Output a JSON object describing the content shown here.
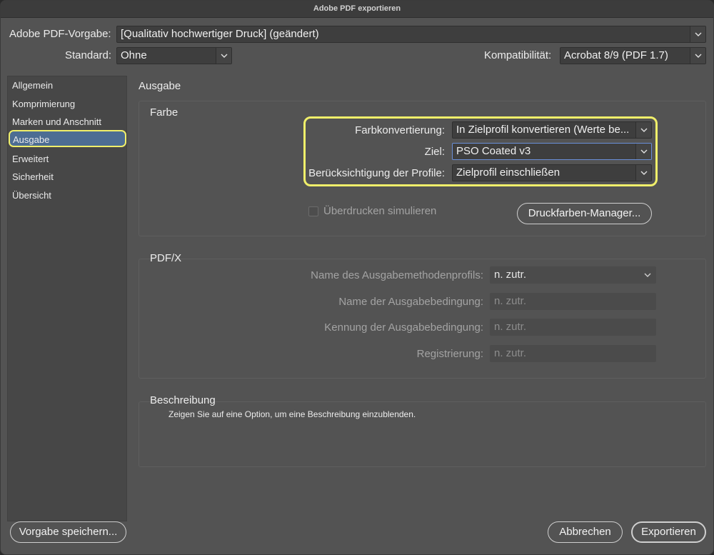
{
  "window": {
    "title": "Adobe PDF exportieren"
  },
  "top": {
    "preset_label": "Adobe PDF-Vorgabe:",
    "preset_value": "[Qualitativ hochwertiger Druck] (geändert)",
    "standard_label": "Standard:",
    "standard_value": "Ohne",
    "compat_label": "Kompatibilität:",
    "compat_value": "Acrobat 8/9 (PDF 1.7)"
  },
  "sidebar": {
    "items": [
      {
        "label": "Allgemein"
      },
      {
        "label": "Komprimierung"
      },
      {
        "label": "Marken und Anschnitt"
      },
      {
        "label": "Ausgabe",
        "selected": true
      },
      {
        "label": "Erweitert"
      },
      {
        "label": "Sicherheit"
      },
      {
        "label": "Übersicht"
      }
    ]
  },
  "main": {
    "section_title": "Ausgabe",
    "farbe": {
      "title": "Farbe",
      "conversion_label": "Farbkonvertierung:",
      "conversion_value": "In Zielprofil konvertieren (Werte be...",
      "target_label": "Ziel:",
      "target_value": "PSO Coated v3",
      "profiles_label": "Berücksichtigung der Profile:",
      "profiles_value": "Zielprofil einschließen",
      "overprint_label": "Überdrucken simulieren",
      "overprint_checked": false,
      "ink_manager_label": "Druckfarben-Manager..."
    },
    "pdfx": {
      "title": "PDF/X",
      "output_profile_label": "Name des Ausgabemethodenprofils:",
      "output_profile_value": "n. zutr.",
      "output_condition_label": "Name der Ausgabebedingung:",
      "output_condition_value": "n. zutr.",
      "condition_id_label": "Kennung der Ausgabebedingung:",
      "condition_id_value": "n. zutr.",
      "registry_label": "Registrierung:",
      "registry_value": "n. zutr."
    },
    "description": {
      "title": "Beschreibung",
      "text": "Zeigen Sie auf eine Option, um eine Beschreibung einzublenden."
    }
  },
  "footer": {
    "save_preset_label": "Vorgabe speichern...",
    "cancel_label": "Abbrechen",
    "export_label": "Exportieren"
  },
  "colors": {
    "highlight": "#f0ef6a",
    "selection": "#4d6d93",
    "focus_border": "#6a8fd8"
  }
}
